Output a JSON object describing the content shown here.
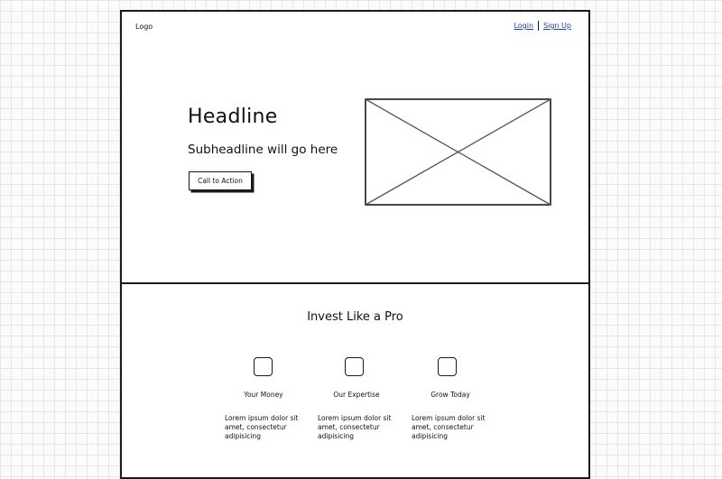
{
  "header": {
    "logo": "Logo",
    "login": "Login",
    "signup": "Sign Up"
  },
  "hero": {
    "headline": "Headline",
    "subheadline": "Subheadline will go here",
    "cta_label": "Call to Action",
    "image_icon": "image-placeholder-icon"
  },
  "features": {
    "title": "Invest Like a Pro",
    "items": [
      {
        "icon": "square-icon",
        "label": "Your Money",
        "desc": "Lorem ipsum dolor sit amet, consectetur adipisicing"
      },
      {
        "icon": "square-icon",
        "label": "Our Expertise",
        "desc": "Lorem ipsum dolor sit amet, consectetur adipisicing"
      },
      {
        "icon": "square-icon",
        "label": "Grow Today",
        "desc": "Lorem ipsum dolor sit amet, consectetur adipisicing"
      }
    ]
  },
  "colors": {
    "stroke": "#1a1a1a",
    "link": "#1a3fa0",
    "grid": "#e6e6e6"
  }
}
